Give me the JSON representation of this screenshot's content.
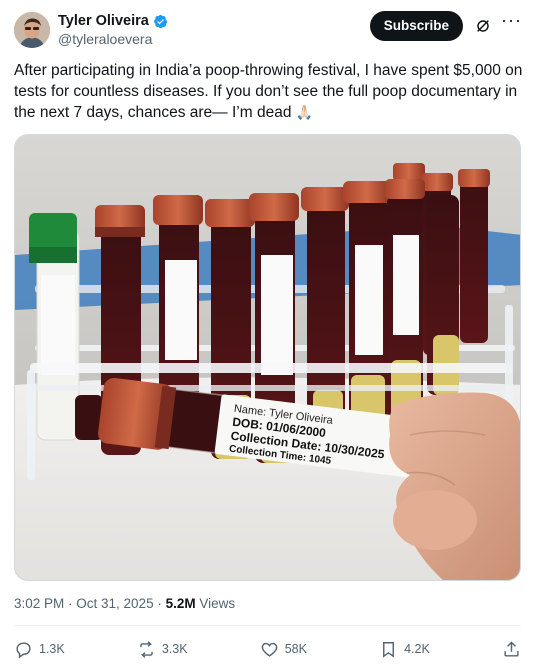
{
  "author": {
    "display_name": "Tyler Oliveira",
    "handle": "@tyleraloevera",
    "verified": true
  },
  "header": {
    "subscribe_label": "Subscribe"
  },
  "tweet": {
    "text": "After participating in India’a poop-throwing festival, I have spent $5,000 on tests for countless diseases. If you don’t see the full poop documentary in the next 7 days, chances are— I’m dead",
    "emoji": "🙏🏻"
  },
  "media": {
    "label_lines": [
      "Name: Tyler Oliveira",
      "DOB: 01/06/2000",
      "Collection Date: 10/30/2025",
      "Collection Time: 1045"
    ],
    "rack_label_lines": [
      "Name: Tyler Oliveira",
      "DOB: 01/06/2000",
      "Collection Date: 10/30/2025",
      "Collection Time: 1045"
    ]
  },
  "meta": {
    "time": "3:02 PM · Oct 31, 2025 · ",
    "views_count": "5.2M",
    "views_label": " Views"
  },
  "actions": {
    "replies": "1.3K",
    "reposts": "3.3K",
    "likes": "58K",
    "bookmarks": "4.2K"
  },
  "colors": {
    "accent": "#1d9bf0",
    "text": "#0f1419",
    "secondary": "#536471"
  },
  "icons": [
    "verified-badge-icon",
    "grok-icon",
    "more-icon",
    "reply-icon",
    "repost-icon",
    "like-icon",
    "bookmark-icon",
    "share-icon"
  ]
}
